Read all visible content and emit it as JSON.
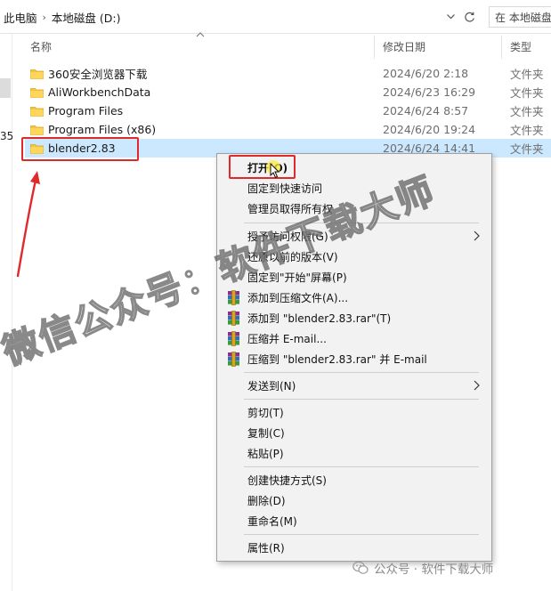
{
  "address": {
    "crumbs": [
      "此电脑",
      "本地磁盘 (D:)"
    ],
    "search_placeholder": "在 本地磁盘"
  },
  "nav": {
    "fragment": "35"
  },
  "columns": {
    "name": "名称",
    "date": "修改日期",
    "type": "类型"
  },
  "files": [
    {
      "name": "360安全浏览器下载",
      "date": "2024/6/20 2:18",
      "type": "文件夹",
      "selected": false
    },
    {
      "name": "AliWorkbenchData",
      "date": "2024/6/23 16:29",
      "type": "文件夹",
      "selected": false
    },
    {
      "name": "Program Files",
      "date": "2024/6/24 8:57",
      "type": "文件夹",
      "selected": false
    },
    {
      "name": "Program Files (x86)",
      "date": "2024/6/20 19:24",
      "type": "文件夹",
      "selected": false
    },
    {
      "name": "blender2.83",
      "date": "2024/6/24 14:41",
      "type": "文件夹",
      "selected": true
    }
  ],
  "context_menu": {
    "items": [
      {
        "label": "打开(O)",
        "bold": true,
        "icon": "",
        "submenu": false
      },
      {
        "label": "固定到快速访问",
        "bold": false,
        "icon": "",
        "submenu": false
      },
      {
        "label": "管理员取得所有权",
        "bold": false,
        "icon": "",
        "submenu": false
      },
      {
        "label": "授予访问权限(G)",
        "bold": false,
        "icon": "",
        "submenu": true
      },
      {
        "label": "还原以前的版本(V)",
        "bold": false,
        "icon": "",
        "submenu": false
      },
      {
        "label": "固定到\"开始\"屏幕(P)",
        "bold": false,
        "icon": "",
        "submenu": false
      },
      {
        "label": "添加到压缩文件(A)...",
        "bold": false,
        "icon": "winrar-icon",
        "submenu": false
      },
      {
        "label": "添加到 \"blender2.83.rar\"(T)",
        "bold": false,
        "icon": "winrar-icon",
        "submenu": false
      },
      {
        "label": "压缩并 E-mail...",
        "bold": false,
        "icon": "winrar-icon",
        "submenu": false
      },
      {
        "label": "压缩到 \"blender2.83.rar\" 并 E-mail",
        "bold": false,
        "icon": "winrar-icon",
        "submenu": false
      },
      {
        "label": "发送到(N)",
        "bold": false,
        "icon": "",
        "submenu": true
      },
      {
        "label": "剪切(T)",
        "bold": false,
        "icon": "",
        "submenu": false
      },
      {
        "label": "复制(C)",
        "bold": false,
        "icon": "",
        "submenu": false
      },
      {
        "label": "粘贴(P)",
        "bold": false,
        "icon": "",
        "submenu": false
      },
      {
        "label": "创建快捷方式(S)",
        "bold": false,
        "icon": "",
        "submenu": false
      },
      {
        "label": "删除(D)",
        "bold": false,
        "icon": "",
        "submenu": false
      },
      {
        "label": "重命名(M)",
        "bold": false,
        "icon": "",
        "submenu": false
      },
      {
        "label": "属性(R)",
        "bold": false,
        "icon": "",
        "submenu": false
      }
    ]
  },
  "watermark": "微信公众号：软件下载大师",
  "footer": "公众号 · 软件下载大师",
  "colors": {
    "selection": "#cce8ff",
    "annotation": "#e02a2a",
    "folder": "#f5c542",
    "menu_bg": "#f2f2f2"
  }
}
